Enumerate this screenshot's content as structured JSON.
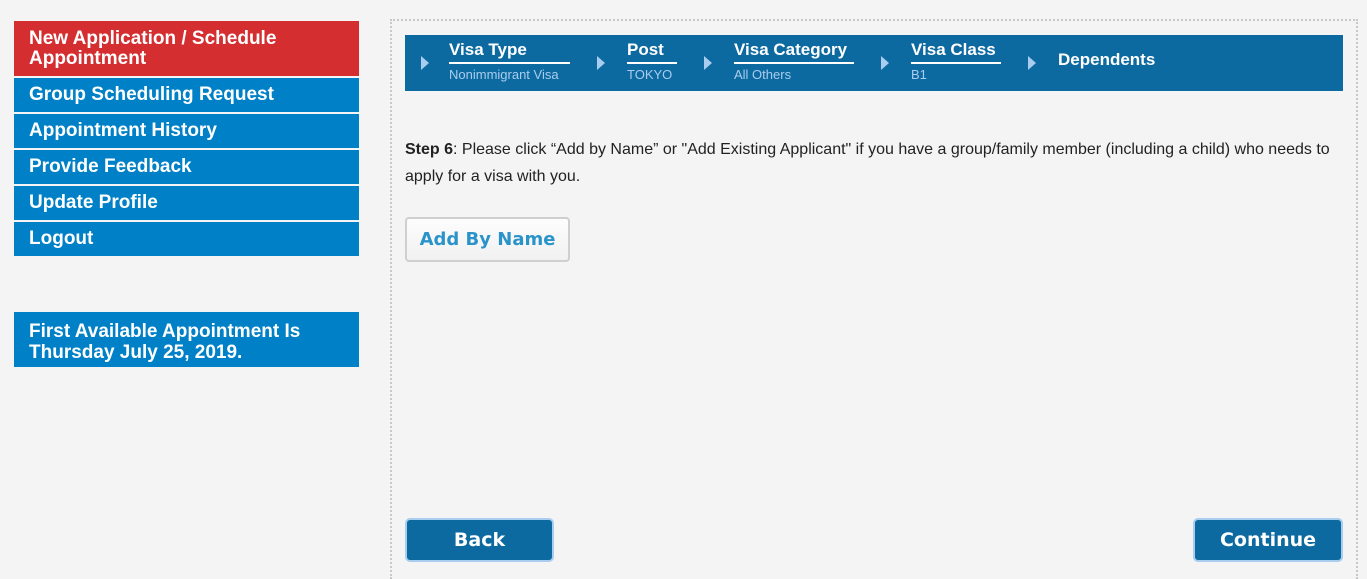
{
  "sidebar": {
    "items": [
      {
        "label": "New Application / Schedule Appointment",
        "active": true
      },
      {
        "label": "Group Scheduling Request"
      },
      {
        "label": "Appointment History"
      },
      {
        "label": "Provide Feedback"
      },
      {
        "label": "Update Profile"
      },
      {
        "label": "Logout"
      }
    ],
    "first_available": "First Available Appointment Is Thursday July 25, 2019."
  },
  "steps": [
    {
      "title": "Visa Type",
      "value": "Nonimmigrant Visa"
    },
    {
      "title": "Post",
      "value": "TOKYO"
    },
    {
      "title": "Visa Category",
      "value": "All Others"
    },
    {
      "title": "Visa Class",
      "value": "B1"
    },
    {
      "title": "Dependents",
      "value": ""
    }
  ],
  "main": {
    "step_label": "Step 6",
    "instructions": ": Please click “Add by Name” or \"Add Existing Applicant\" if you have a group/family member (including a child) who needs to apply for a visa with you.",
    "add_by_name": "Add By Name",
    "back": "Back",
    "continue": "Continue"
  }
}
